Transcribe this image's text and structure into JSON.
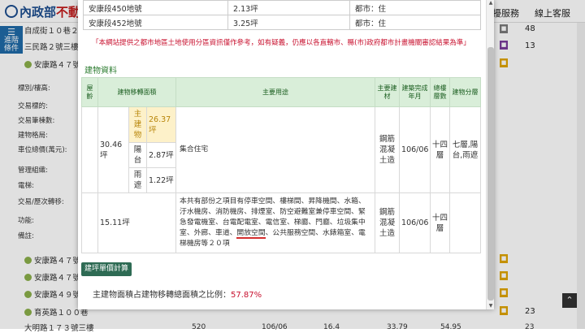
{
  "header": {
    "logo_text_blue": "內政部",
    "logo_text_red": "不動",
    "menu_service": "擾服務",
    "menu_online": "線上客服"
  },
  "side_button": {
    "line1": "進階",
    "line2": "條件"
  },
  "background_rows": [
    {
      "label": "自成街１０巷２",
      "right": "48"
    },
    {
      "label": "三民路２號三樓",
      "right": "13"
    },
    {
      "label": "安康路４７號"
    }
  ],
  "background_fields": [
    "標別/樓高:",
    "交易標的:",
    "交易筆棟數:",
    "建物格局:",
    "車位總價(萬元):",
    "管理組織:",
    "電梯:",
    "交易/歷次轉移:",
    "功能:",
    "備註:"
  ],
  "background_bottom_rows": [
    {
      "label": "安康路４７號１"
    },
    {
      "label": "安康路４７號２"
    },
    {
      "label": "安康路４９號１"
    },
    {
      "label": "育英路１００巷",
      "right": "23"
    },
    {
      "label": "大明路１７３號三樓"
    }
  ],
  "bottom_strip": {
    "c1": "520",
    "c2": "106/06",
    "c3": "16.4",
    "c4": "33.79",
    "c5": "54.95",
    "c6": "23"
  },
  "land_rows": [
    {
      "name": "安康段450地號",
      "area": "2.13坪",
      "zone": "都市：住"
    },
    {
      "name": "安康段452地號",
      "area": "3.25坪",
      "zone": "都市：住"
    }
  ],
  "notice": "「本網站提供之都市地區土地使用分區資訊僅作參考，如有疑義，仍應以各直轄市、縣(市)政府都市計畫機關審認結果為準」",
  "section_title": "建物資料",
  "building_table": {
    "headers": {
      "age": "屋齡",
      "area": "建物移轉面積",
      "use": "主要用途",
      "material": "主要建材",
      "completion": "建築完成年月",
      "floors": "總樓層數",
      "layout": "建物分層"
    },
    "row1": {
      "age": "",
      "total_area": "30.46坪",
      "main_label": "主建物",
      "main_area": "26.37坪",
      "balcony_label": "陽台",
      "balcony_area": "2.87坪",
      "rain_label": "雨遮",
      "rain_area": "1.22坪",
      "use": "集合住宅",
      "material": "鋼筋混凝土造",
      "completion": "106/06",
      "floors": "十四層",
      "layout": "七層,陽台,雨遮"
    },
    "row2": {
      "age": "",
      "area": "15.11坪",
      "use_before": "本共有部份之項目有停車空間、樓梯間、昇降機間、水箱、汙水機房、消防機房、排煙室、防空避難室兼停車空間、緊急發電機室、台電配電室、電信室、梯廳、門廳、垃圾集中室、外廊、車道、",
      "use_highlight": "開放空間",
      "use_after": "、公共服務空間、水錶箱室、電梯機房等２０項",
      "material": "鋼筋混凝土造",
      "completion": "106/06",
      "floors": "十四層",
      "layout": ""
    }
  },
  "calc_button": "建坪單價計算",
  "ratio_text": "主建物面積占建物移轉總面積之比例：",
  "ratio_value": "57.87%",
  "icons": {
    "scroll_top": "chevron-up-icon",
    "menu": "hamburger-icon"
  }
}
